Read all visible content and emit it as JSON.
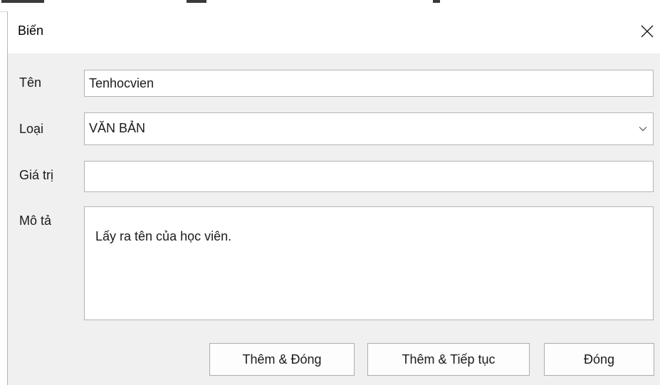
{
  "dialog": {
    "title": "Biến",
    "close_icon": "close-icon"
  },
  "form": {
    "name_label": "Tên",
    "name_value": "Tenhocvien",
    "type_label": "Loại",
    "type_value": "VĂN BẢN",
    "type_icon": "chevron-down-icon",
    "value_label": "Giá trị",
    "value_value": "",
    "description_label": "Mô tả",
    "description_value": "Lấy ra tên của học viên."
  },
  "buttons": {
    "add_close": "Thêm & Đóng",
    "add_continue": "Thêm & Tiếp tục",
    "close": "Đóng"
  },
  "colors": {
    "window_bg": "#f0f0f0",
    "titlebar_bg": "#ffffff",
    "border": "#b4b4b4"
  }
}
